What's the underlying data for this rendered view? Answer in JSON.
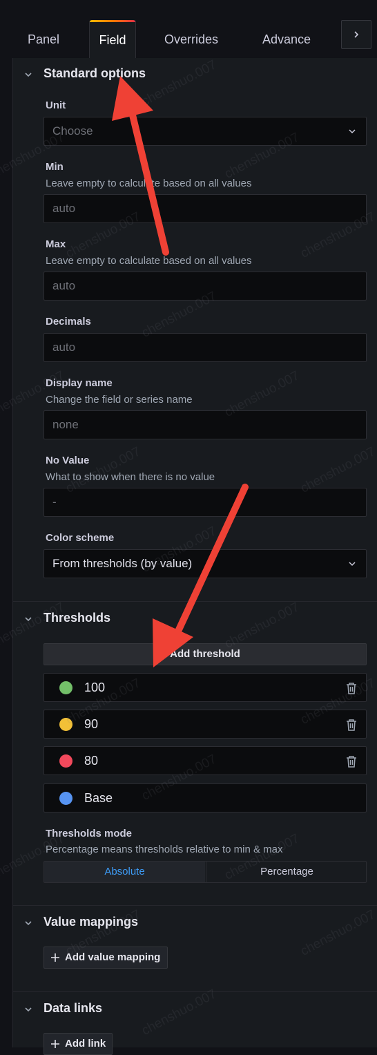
{
  "tabs": {
    "panel": "Panel",
    "field": "Field",
    "overrides": "Overrides",
    "advance": "Advance",
    "more_icon": "chevron-right-icon"
  },
  "standard_options": {
    "title": "Standard options",
    "unit": {
      "label": "Unit",
      "placeholder": "Choose"
    },
    "min": {
      "label": "Min",
      "description": "Leave empty to calculate based on all values",
      "placeholder": "auto"
    },
    "max": {
      "label": "Max",
      "description": "Leave empty to calculate based on all values",
      "placeholder": "auto"
    },
    "decimals": {
      "label": "Decimals",
      "placeholder": "auto"
    },
    "display_name": {
      "label": "Display name",
      "description": "Change the field or series name",
      "placeholder": "none"
    },
    "no_value": {
      "label": "No Value",
      "description": "What to show when there is no value",
      "placeholder": "-"
    },
    "color_scheme": {
      "label": "Color scheme",
      "value": "From thresholds (by value)"
    }
  },
  "thresholds": {
    "title": "Thresholds",
    "add_label": "Add threshold",
    "items": [
      {
        "value": "100",
        "color": "#73bf69",
        "deletable": true
      },
      {
        "value": "90",
        "color": "#f2c037",
        "deletable": true
      },
      {
        "value": "80",
        "color": "#f2495c",
        "deletable": true
      },
      {
        "value": "Base",
        "color": "#5794f2",
        "deletable": false
      }
    ],
    "mode": {
      "label": "Thresholds mode",
      "description": "Percentage means thresholds relative to min & max",
      "options": [
        "Absolute",
        "Percentage"
      ],
      "selected": "Absolute"
    }
  },
  "value_mappings": {
    "title": "Value mappings",
    "add_label": "Add value mapping"
  },
  "data_links": {
    "title": "Data links",
    "add_label": "Add link"
  },
  "watermark": "chenshuo.007",
  "colors": {
    "accent": "#3d9bf5",
    "annotation_arrow": "#ef4135"
  }
}
